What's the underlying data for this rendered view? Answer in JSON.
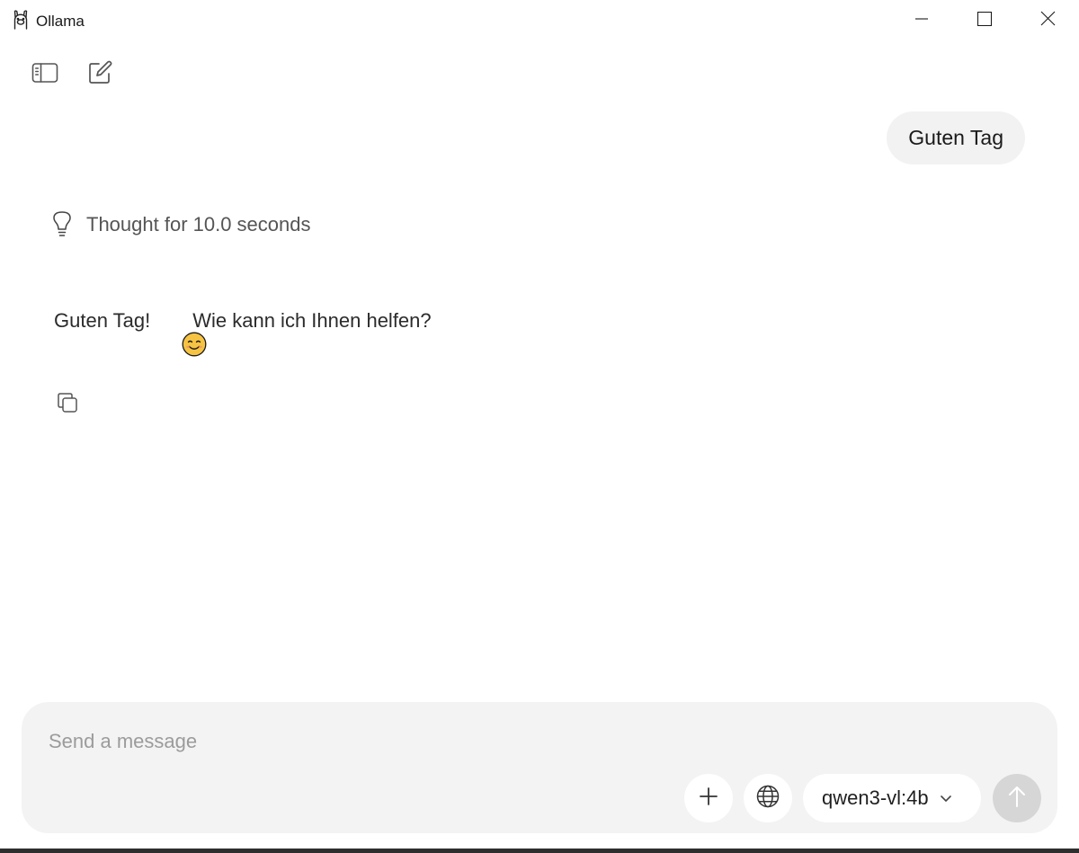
{
  "window": {
    "title": "Ollama",
    "logo_icon": "llama-icon",
    "controls": [
      "minimize-icon",
      "maximize-icon",
      "close-icon"
    ]
  },
  "toolbar": {
    "icons": [
      "sidebar-toggle-icon",
      "new-chat-icon"
    ]
  },
  "conversation": {
    "user_message": "Guten Tag",
    "thought_label": "Thought for 10.0 seconds",
    "assistant_before_emoji": "Guten Tag!",
    "assistant_emoji": "smiling-face-icon",
    "assistant_after_emoji": "Wie kann ich Ihnen helfen?",
    "copy_icon": "copy-icon"
  },
  "composer": {
    "placeholder": "Send a message",
    "value": "",
    "model": "qwen3-vl:4b",
    "icons": [
      "plus-icon",
      "globe-icon",
      "chevron-down-icon",
      "arrow-up-icon"
    ]
  },
  "colors": {
    "background": "#ffffff",
    "bubble": "#f2f2f2",
    "composer": "#f3f3f3",
    "send_disabled": "#d6d6d6",
    "emoji": "#f6c343"
  }
}
